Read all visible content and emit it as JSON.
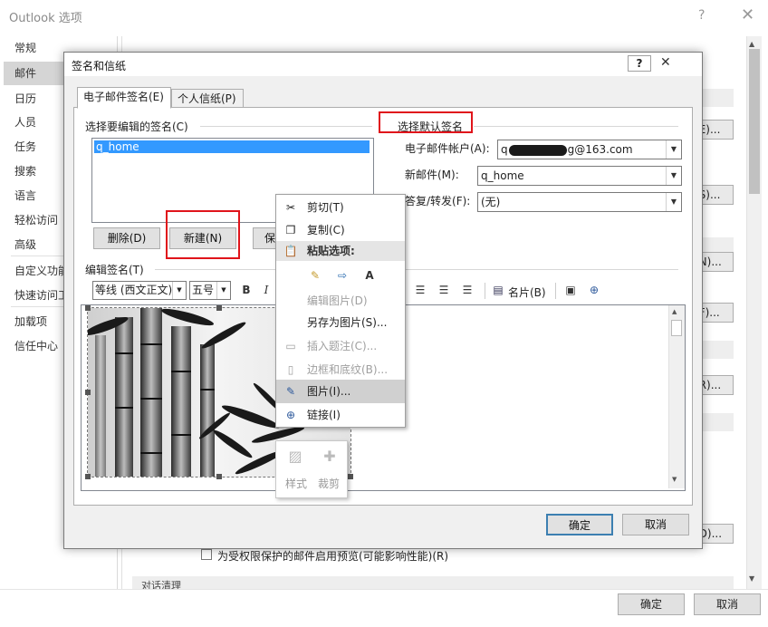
{
  "outer": {
    "title": "Outlook 选项",
    "help_glyph": "?",
    "close_glyph": "✕",
    "nav": [
      "常规",
      "邮件",
      "日历",
      "人员",
      "任务",
      "搜索",
      "语言",
      "轻松访问",
      "高级",
      "自定义功能区",
      "快速访问工具栏",
      "加载项",
      "信任中心"
    ],
    "right_buttons": [
      "(E)...",
      "(S)...",
      "(N)...",
      "(F)...",
      "(R)...",
      "(D)..."
    ],
    "checkbox_label": "为受权限保护的邮件启用预览(可能影响性能)(R)",
    "section_label": "对话清理",
    "ok_label": "确定",
    "cancel_label": "取消"
  },
  "dialog": {
    "title": "签名和信纸",
    "help_glyph": "?",
    "close_glyph": "✕",
    "tabs": [
      "电子邮件签名(E)",
      "个人信纸(P)"
    ],
    "select_sig_label": "选择要编辑的签名(C)",
    "signatures": [
      "q_home"
    ],
    "delete_label": "删除(D)",
    "new_label": "新建(N)",
    "save_label": "保存",
    "default_sig_label": "选择默认签名",
    "account_label": "电子邮件帐户(A):",
    "account_prefix": "q",
    "account_suffix": "g@163.com",
    "new_msg_label": "新邮件(M):",
    "new_msg_value": "q_home",
    "reply_label": "答复/转发(F):",
    "reply_value": "(无)",
    "edit_sig_label": "编辑签名(T)",
    "font_value": "等线 (西文正文)",
    "size_value": "五号",
    "bold_glyph": "B",
    "italic_glyph": "I",
    "card_label": "名片(B)",
    "ok_label": "确定",
    "cancel_label": "取消"
  },
  "context_menu": {
    "cut": "剪切(T)",
    "copy": "复制(C)",
    "paste_options": "粘贴选项:",
    "edit_picture": "编辑图片(D)",
    "save_as_picture": "另存为图片(S)...",
    "insert_caption": "插入题注(C)...",
    "borders_shading": "边框和底纹(B)...",
    "picture": "图片(I)...",
    "link": "链接(I)",
    "style_label": "样式",
    "crop_label": "裁剪"
  }
}
